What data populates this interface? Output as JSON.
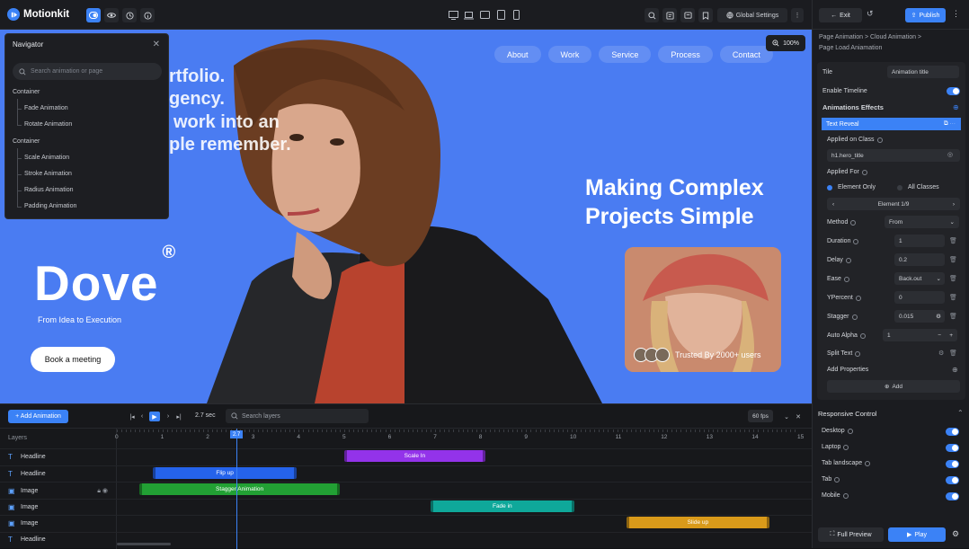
{
  "app": {
    "name": "Motionkit"
  },
  "topbar": {
    "zoom": "100%",
    "global_settings": "Global Settings"
  },
  "canvas": {
    "nav": [
      "About",
      "Work",
      "Service",
      "Process",
      "Contact"
    ],
    "hero_lines": [
      "rtfolio.",
      "gency.",
      "work into an",
      "ple remember."
    ],
    "brand": "Dove",
    "brand_mark": "®",
    "tagline": "From Idea to Execution",
    "cta": "Book a meeting",
    "headline_1": "Making Complex",
    "headline_2": "Projects Simple",
    "trusted": "Trusted By 2000+ users"
  },
  "navigator": {
    "title": "Navigator",
    "search_placeholder": "Search animation or page",
    "groups": [
      {
        "label": "Container",
        "items": [
          "Fade Animation",
          "Rotate Animation"
        ]
      },
      {
        "label": "Container",
        "items": [
          "Scale Animation",
          "Stroke Animation",
          "Radius Animation",
          "Padding Animation"
        ]
      }
    ]
  },
  "right_panel": {
    "exit": "Exit",
    "publish": "Publish",
    "breadcrumb_1": "Page Animation  >  Cloud Animation  >",
    "breadcrumb_2": "Page Load Aniamation",
    "title_label": "Tile",
    "title_value": "Animation title",
    "enable_timeline": "Enable Timeline",
    "effects_header": "Animations Effects",
    "selected_effect": "Text Reveal",
    "applied_on_class": "Applied on Class",
    "class_value": "h1.hero_title",
    "applied_for": "Applied For",
    "element_only": "Element Only",
    "all_classes": "All Classes",
    "element_index": "Element 1/9",
    "method_label": "Method",
    "method_value": "From",
    "duration_label": "Duration",
    "duration_value": "1",
    "delay_label": "Delay",
    "delay_value": "0.2",
    "ease_label": "Ease",
    "ease_value": "Back.out",
    "ypercent_label": "YPercent",
    "ypercent_value": "0",
    "stagger_label": "Stagger",
    "stagger_value": "0.015",
    "auto_alpha_label": "Auto Alpha",
    "auto_alpha_value": "1",
    "split_text_label": "Split Text",
    "add_properties": "Add Properties",
    "add": "Add",
    "responsive_header": "Responsive Control",
    "responsive": [
      "Desktop",
      "Laptop",
      "Tab landscape",
      "Tab",
      "Mobile"
    ],
    "full_preview": "Full Preview",
    "play": "Play"
  },
  "timeline": {
    "add_animation": "+ Add Animation",
    "time": "2.7 sec",
    "search_placeholder": "Search layers",
    "fps": "60 fps",
    "layers_header": "Layers",
    "playhead": "2.7",
    "ticks": [
      "0",
      "1",
      "2",
      "3",
      "4",
      "5",
      "6",
      "7",
      "8",
      "9",
      "10",
      "11",
      "12",
      "13",
      "14",
      "15"
    ],
    "layers": [
      {
        "type": "text",
        "name": "Headline"
      },
      {
        "type": "text",
        "name": "Headline"
      },
      {
        "type": "image",
        "name": "Image"
      },
      {
        "type": "image",
        "name": "Image"
      },
      {
        "type": "image",
        "name": "Image"
      },
      {
        "type": "text",
        "name": "Headline"
      }
    ],
    "bars": [
      {
        "label": "Scale In",
        "start": 5,
        "end": 8.1,
        "color": "#9333ea"
      },
      {
        "label": "Flip up",
        "start": 0.8,
        "end": 3.95,
        "color": "#2563eb"
      },
      {
        "label": "Stagger Animation",
        "start": 0.5,
        "end": 4.9,
        "color": "#22a034"
      },
      {
        "label": "Fade in",
        "start": 6.9,
        "end": 10.05,
        "color": "#0fa89a"
      },
      {
        "label": "Slide up",
        "start": 11.2,
        "end": 14.35,
        "color": "#d99a1a"
      }
    ]
  },
  "colors": {
    "accent": "#3b82f6",
    "canvas_bg": "#4a7cf2"
  }
}
